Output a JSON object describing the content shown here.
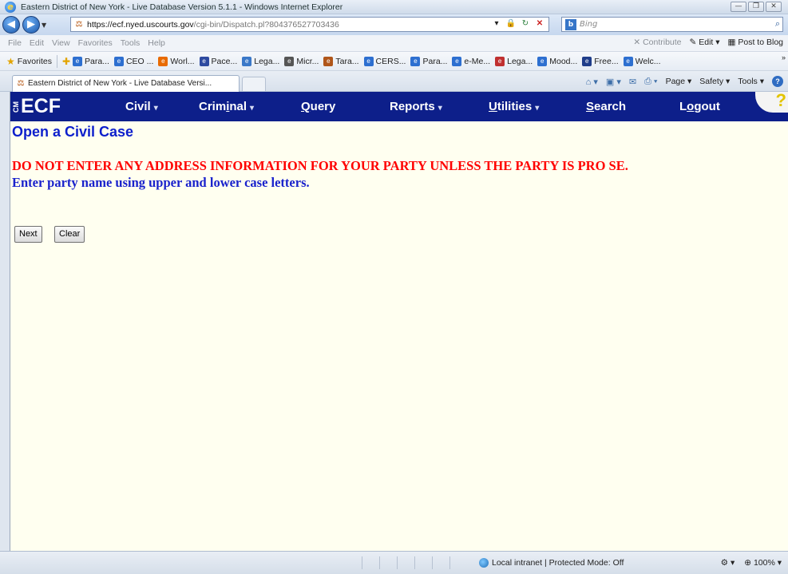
{
  "window": {
    "title": "Eastern District of New York - Live Database Version 5.1.1 - Windows Internet Explorer",
    "controls": [
      "—",
      "❐",
      "✕"
    ]
  },
  "address_bar": {
    "url_host": "https://ecf.nyed.uscourts.gov",
    "url_rest": "/cgi-bin/Dispatch.pl?804376527703436",
    "search_placeholder": "Bing"
  },
  "menu_bar": {
    "items": [
      "File",
      "Edit",
      "View",
      "Favorites",
      "Tools",
      "Help"
    ],
    "contribute": "Contribute",
    "edit": "Edit",
    "post_to_blog": "Post to Blog"
  },
  "favorites_bar": {
    "label": "Favorites",
    "items": [
      {
        "label": "Para...",
        "icon": "ie-page-icon",
        "color": "#2d6fd0"
      },
      {
        "label": "CEO ...",
        "icon": "ie-page-icon",
        "color": "#2d6fd0"
      },
      {
        "label": "Worl...",
        "icon": "orange-ring-icon",
        "color": "#e86a00"
      },
      {
        "label": "Pace...",
        "icon": "pace-logo-icon",
        "color": "#2d4aa0"
      },
      {
        "label": "Lega...",
        "icon": "hb-logo-icon",
        "color": "#3a78c8"
      },
      {
        "label": "Micr...",
        "icon": "building-icon",
        "color": "#555555"
      },
      {
        "label": "Tara...",
        "icon": "tara-icon",
        "color": "#b0561a"
      },
      {
        "label": "CERS...",
        "icon": "ie-page-icon",
        "color": "#2d6fd0"
      },
      {
        "label": "Para...",
        "icon": "ie-page-icon",
        "color": "#2d6fd0"
      },
      {
        "label": "e-Me...",
        "icon": "ie-page-icon",
        "color": "#2d6fd0"
      },
      {
        "label": "Lega...",
        "icon": "legal-icon",
        "color": "#c03030"
      },
      {
        "label": "Mood...",
        "icon": "ie-page-icon",
        "color": "#2d6fd0"
      },
      {
        "label": "Free...",
        "icon": "free-icon",
        "color": "#1f3d8a"
      },
      {
        "label": "Welc...",
        "icon": "ie-page-icon",
        "color": "#2d6fd0"
      }
    ]
  },
  "tabs": {
    "active": "Eastern District of New York - Live Database Versi..."
  },
  "command_bar": {
    "page": "Page",
    "safety": "Safety",
    "tools": "Tools"
  },
  "ecf_nav": {
    "logo": "ECF",
    "logo_prefix": "CM",
    "items": [
      {
        "label": "Civil",
        "has_menu": true
      },
      {
        "label": "Criminal",
        "has_menu": true
      },
      {
        "label": "Query",
        "has_menu": false
      },
      {
        "label": "Reports",
        "has_menu": true
      },
      {
        "label": "Utilities",
        "has_menu": true
      },
      {
        "label": "Search",
        "has_menu": false
      },
      {
        "label": "Logout",
        "has_menu": false
      }
    ],
    "help": "?"
  },
  "content": {
    "page_title": "Open a Civil Case",
    "warning": "DO NOT ENTER ANY ADDRESS INFORMATION FOR YOUR PARTY UNLESS THE PARTY IS PRO SE.",
    "hint": "Enter party name using upper and lower case letters.",
    "next_button": "Next",
    "clear_button": "Clear"
  },
  "status_bar": {
    "zone": "Local intranet | Protected Mode: Off",
    "zoom": "100%"
  },
  "colors": {
    "ecf_nav_bg": "#0d1f8a",
    "page_bg": "#fffff0",
    "title_blue": "#0d1fcc",
    "warning_red": "#ff0000"
  }
}
